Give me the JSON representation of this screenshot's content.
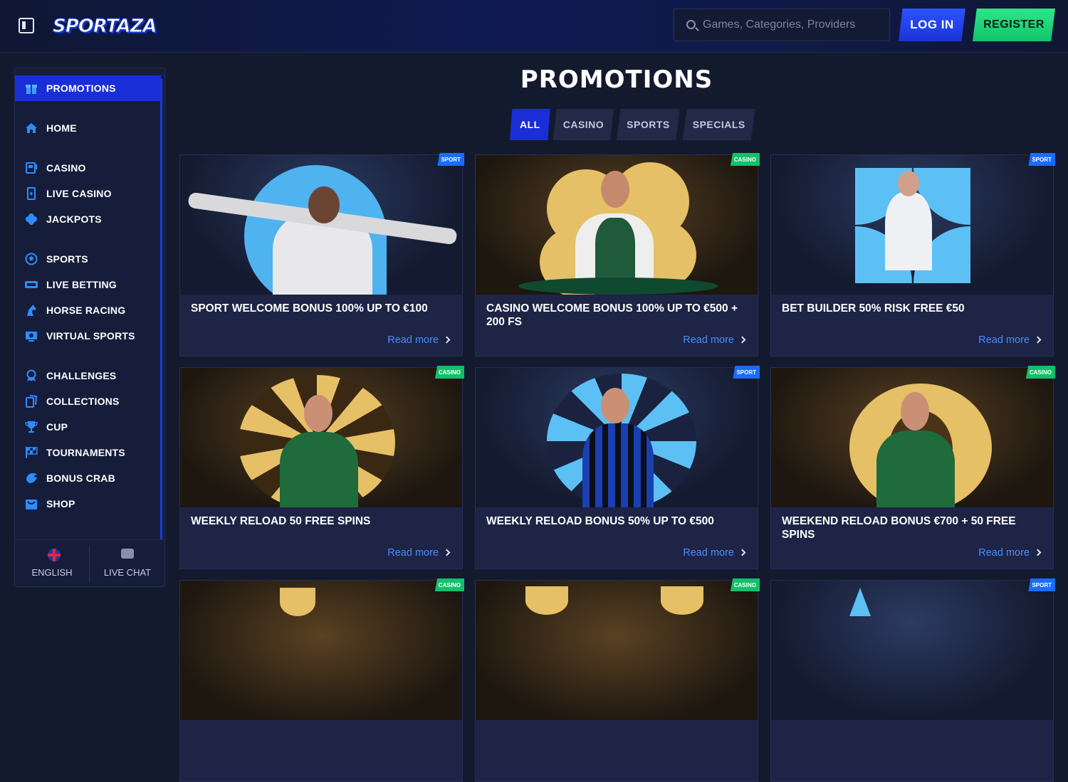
{
  "header": {
    "logo_text": "SPORTAZA",
    "search_placeholder": "Games, Categories, Providers",
    "login_label": "LOG IN",
    "register_label": "REGISTER"
  },
  "sidebar": {
    "items": [
      {
        "label": "PROMOTIONS",
        "icon": "gift-icon",
        "active": true
      },
      {
        "label": "HOME",
        "icon": "home-icon"
      },
      {
        "label": "CASINO",
        "icon": "slot-machine-icon"
      },
      {
        "label": "LIVE CASINO",
        "icon": "card-icon"
      },
      {
        "label": "JACKPOTS",
        "icon": "clover-icon"
      },
      {
        "label": "SPORTS",
        "icon": "soccer-ball-icon"
      },
      {
        "label": "LIVE BETTING",
        "icon": "live-icon"
      },
      {
        "label": "HORSE RACING",
        "icon": "horse-icon"
      },
      {
        "label": "VIRTUAL SPORTS",
        "icon": "virtual-screen-icon"
      },
      {
        "label": "CHALLENGES",
        "icon": "award-icon"
      },
      {
        "label": "COLLECTIONS",
        "icon": "collection-cards-icon"
      },
      {
        "label": "CUP",
        "icon": "trophy-icon"
      },
      {
        "label": "TOURNAMENTS",
        "icon": "checkered-flag-icon"
      },
      {
        "label": "BONUS CRAB",
        "icon": "crab-claw-icon"
      },
      {
        "label": "SHOP",
        "icon": "shop-icon"
      }
    ],
    "footer": {
      "language_label": "ENGLISH",
      "chat_label": "LIVE CHAT"
    }
  },
  "main": {
    "title": "PROMOTIONS",
    "tabs": [
      {
        "label": "ALL",
        "active": true
      },
      {
        "label": "CASINO"
      },
      {
        "label": "SPORTS"
      },
      {
        "label": "SPECIALS"
      }
    ],
    "read_more_label": "Read more",
    "cards": [
      {
        "title": "SPORT WELCOME BONUS 100% UP TO €100",
        "badge": "SPORT"
      },
      {
        "title": "CASINO WELCOME BONUS 100% UP TO €500 + 200 FS",
        "badge": "CASINO"
      },
      {
        "title": "BET BUILDER 50% RISK FREE €50",
        "badge": "SPORT"
      },
      {
        "title": "WEEKLY RELOAD 50 FREE SPINS",
        "badge": "CASINO"
      },
      {
        "title": "WEEKLY RELOAD BONUS 50% UP TO €500",
        "badge": "SPORT"
      },
      {
        "title": "WEEKEND RELOAD BONUS €700 + 50 FREE SPINS",
        "badge": "CASINO"
      },
      {
        "title": "",
        "badge": "CASINO"
      },
      {
        "title": "",
        "badge": "CASINO"
      },
      {
        "title": "",
        "badge": "SPORT"
      }
    ]
  },
  "colors": {
    "accent_blue": "#1a2ed8",
    "register_green": "#13c06a",
    "link_blue": "#4a8dff",
    "background": "#141a2e"
  }
}
